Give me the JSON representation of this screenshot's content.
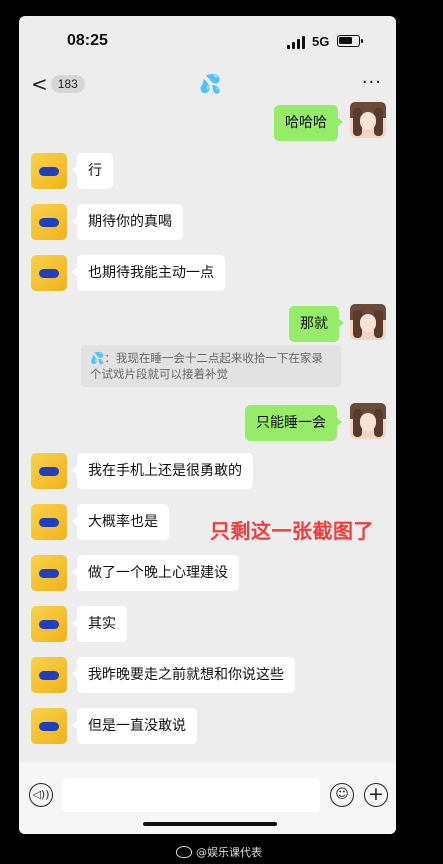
{
  "status": {
    "time": "08:25",
    "network": "5G"
  },
  "nav": {
    "back_chevron": "<",
    "unread_count": "183",
    "title_emoji": "💦",
    "more": "···"
  },
  "messages": [
    {
      "side": "right",
      "text": "哈哈哈"
    },
    {
      "side": "left",
      "text": "行"
    },
    {
      "side": "left",
      "text": "期待你的真喝"
    },
    {
      "side": "left",
      "text": "也期待我能主动一点"
    },
    {
      "side": "right",
      "text": "那就"
    },
    {
      "side": "right",
      "text": "只能睡一会"
    },
    {
      "side": "left",
      "text": "我在手机上还是很勇敢的"
    },
    {
      "side": "left",
      "text": "大概率也是"
    },
    {
      "side": "left",
      "text": "做了一个晚上心理建设"
    },
    {
      "side": "left",
      "text": "其实"
    },
    {
      "side": "left",
      "text": "我昨晚要走之前就想和你说这些"
    },
    {
      "side": "left",
      "text": "但是一直没敢说"
    }
  ],
  "quote": {
    "text": "💦：我现在睡一会十二点起来收拾一下在家录个试戏片段就可以接着补觉"
  },
  "overlay_caption": "只剩这一张截图了",
  "input_bar": {
    "voice_icon": "voice-icon",
    "emoji_icon": "emoji-icon",
    "plus_icon": "plus-icon"
  },
  "watermark": "@娱乐课代表"
}
